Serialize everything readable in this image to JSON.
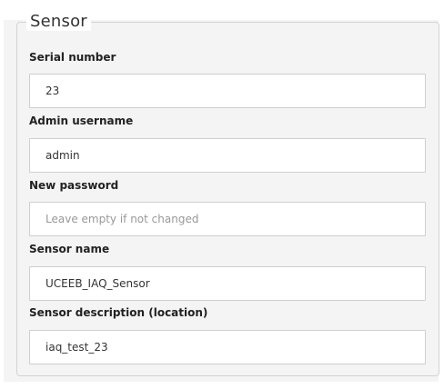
{
  "fieldset": {
    "legend": "Sensor"
  },
  "fields": {
    "serial_number": {
      "label": "Serial number",
      "value": "23",
      "placeholder": ""
    },
    "admin_username": {
      "label": "Admin username",
      "value": "admin",
      "placeholder": ""
    },
    "new_password": {
      "label": "New password",
      "value": "",
      "placeholder": "Leave empty if not changed"
    },
    "sensor_name": {
      "label": "Sensor name",
      "value": "UCEEB_IAQ_Sensor",
      "placeholder": ""
    },
    "sensor_description": {
      "label": "Sensor description (location)",
      "value": "iaq_test_23",
      "placeholder": ""
    }
  }
}
